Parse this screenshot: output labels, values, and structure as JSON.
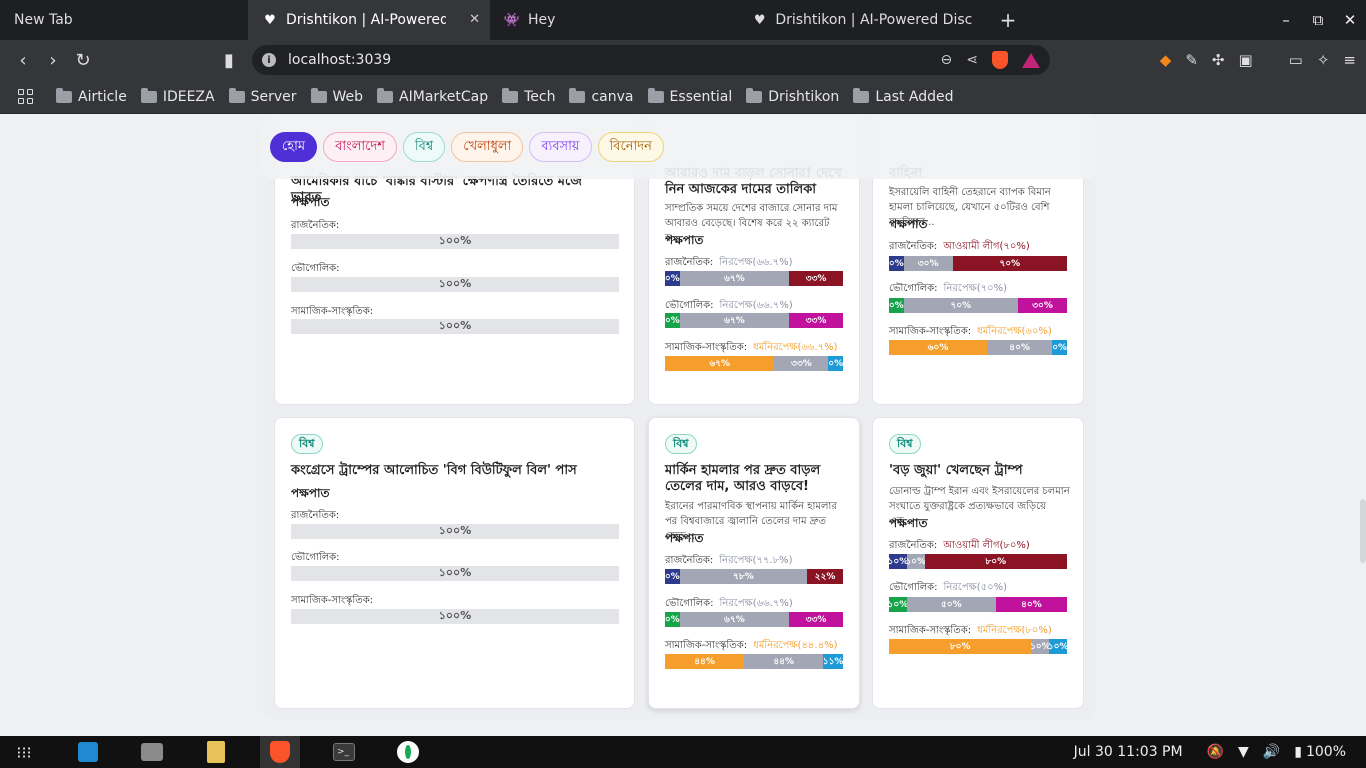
{
  "browser": {
    "tabs": [
      {
        "title": "New Tab",
        "icon": "none",
        "active": false
      },
      {
        "title": "Drishtikon | AI-Powered D",
        "icon": "heart-icon",
        "active": true
      },
      {
        "title": "Hey",
        "icon": "ghost-icon",
        "active": false
      },
      {
        "title": "Drishtikon | AI-Powered Disco",
        "icon": "heart-icon",
        "active": false
      }
    ],
    "address": "localhost:3039",
    "bookmarks": [
      "Airticle",
      "IDEEZA",
      "Server",
      "Web",
      "AIMarketCap",
      "Tech",
      "canva",
      "Essential",
      "Drishtikon",
      "Last Added"
    ]
  },
  "nav": {
    "categories": [
      "হোম",
      "বাংলাদেশ",
      "বিশ্ব",
      "খেলাধুলা",
      "ব্যবসায়",
      "বিনোদন"
    ]
  },
  "labels": {
    "bias": "পক্ষপাত",
    "political": "রাজনৈতিক:",
    "geographic": "ভৌগোলিক:",
    "sociocultural": "সামাজিক-সাংস্কৃতিক:",
    "full": "১০০%"
  },
  "cards": [
    {
      "title": "আমেরিকার ধাচে 'বাঙ্কার বাস্টার' ক্ষেপণাস্ত্র তৈরিতে মজে ভারত"
    },
    {
      "title": "আবারও দাম বাড়ল সোনার! দেখে নিন আজকের দামের তালিকা",
      "summary": "সাম্প্রতিক সময়ে দেশের বাজারে সোনার দাম আবারও বেড়েছে। বিশেষ করে ২২ ক্যারেট স্ব...",
      "political_tag": "নিরপেক্ষ(৬৬.৭%)",
      "political_vals": [
        "০%",
        "৬৭%",
        "৩৩%"
      ],
      "political_pct": [
        0,
        67,
        33
      ],
      "geo_tag": "নিরপেক্ষ(৬৬.৭%)",
      "geo_vals": [
        "০%",
        "৬৭%",
        "৩৩%"
      ],
      "geo_pct": [
        0,
        67,
        33
      ],
      "soc_tag": "ধর্মনিরপেক্ষ(৬৬.৭%)",
      "soc_vals": [
        "৬৭%",
        "৩৩%",
        "০%"
      ],
      "soc_pct": [
        67,
        33,
        0
      ]
    },
    {
      "title": "বাহিনা",
      "summary": "ইসরায়েলি বাহিনী তেহরানে ব্যাপক বিমান হামলা চালিয়েছে, যেখানে ৫০টিরও বেশি যুদ্ধবিমান...",
      "political_tag": "আওয়ামী লীগ(৭০%)",
      "political_vals": [
        "০%",
        "৩০%",
        "৭০%"
      ],
      "political_pct": [
        0,
        30,
        70
      ],
      "geo_tag": "নিরপেক্ষ(৭০%)",
      "geo_vals": [
        "০%",
        "৭০%",
        "৩০%"
      ],
      "geo_pct": [
        0,
        70,
        30
      ],
      "soc_tag": "ধর্মনিরপেক্ষ(৬০%)",
      "soc_vals": [
        "৬০%",
        "৪০%",
        "০%"
      ],
      "soc_pct": [
        60,
        40,
        0
      ]
    },
    {
      "badge": "বিশ্ব",
      "title": "কংগ্রেসে ট্রাম্পের আলোচিত 'বিগ বিউটিফুল বিল' পাস"
    },
    {
      "badge": "বিশ্ব",
      "title": "মার্কিন হামলার পর দ্রুত বাড়ল তেলের দাম, আরও বাড়বে!",
      "summary": "ইরানের পারমাণবিক স্থাপনায় মার্কিন হামলার পর বিশ্ববাজারে জ্বালানি তেলের দাম দ্রুত বেড়ে...",
      "political_tag": "নিরপেক্ষ(৭৭.৮%)",
      "political_vals": [
        "০%",
        "৭৮%",
        "২২%"
      ],
      "political_pct": [
        0,
        78,
        22
      ],
      "geo_tag": "নিরপেক্ষ(৬৬.৭%)",
      "geo_vals": [
        "০%",
        "৬৭%",
        "৩৩%"
      ],
      "geo_pct": [
        0,
        67,
        33
      ],
      "soc_tag": "ধর্মনিরপেক্ষ(৪৪.৪%)",
      "soc_vals": [
        "৪৪%",
        "৪৪%",
        "১১%"
      ],
      "soc_pct": [
        44,
        44,
        11
      ]
    },
    {
      "badge": "বিশ্ব",
      "title": "'বড় জুয়া' খেলছেন ট্রাম্প",
      "summary": "ডোনাল্ড ট্রাম্প ইরান এবং ইসরায়েলের চলমান সংঘাতে যুক্তরাষ্ট্রকে প্রত্যক্ষভাবে জড়িয়ে এক...",
      "political_tag": "আওয়ামী লীগ(৮০%)",
      "political_vals": [
        "১০%",
        "১০%",
        "৮০%"
      ],
      "political_pct": [
        10,
        10,
        80
      ],
      "geo_tag": "নিরপেক্ষ(৫০%)",
      "geo_vals": [
        "১০%",
        "৫০%",
        "৪০%"
      ],
      "geo_pct": [
        10,
        50,
        40
      ],
      "soc_tag": "ধর্মনিরপেক্ষ(৮০%)",
      "soc_vals": [
        "৮০%",
        "১০%",
        "১০%"
      ],
      "soc_pct": [
        80,
        10,
        10
      ]
    }
  ],
  "colors": {
    "political": [
      "#2e3a8c",
      "#a3a6b4",
      "#8b1424"
    ],
    "geographic": [
      "#16a34a",
      "#a3a6b4",
      "#c0129c"
    ],
    "sociocultural": [
      "#f59e2b",
      "#a3a6b4",
      "#1e9bd7"
    ],
    "tag_neutral": "#8a8fa3",
    "tag_awami": "#8b1424",
    "tag_secular": "#f59e2b"
  },
  "taskbar": {
    "datetime": "Jul 30  11:03 PM",
    "battery": "100%"
  }
}
